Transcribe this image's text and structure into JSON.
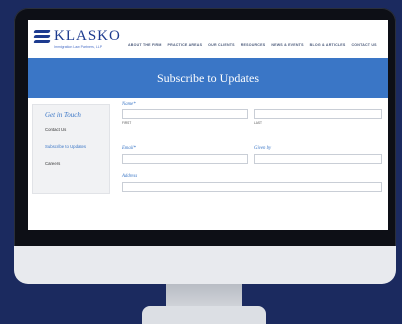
{
  "brand": {
    "name": "KLASKO",
    "tagline": "Immigration Law Partners, LLP"
  },
  "nav": [
    "ABOUT THE FIRM",
    "PRACTICE AREAS",
    "OUR CLIENTS",
    "RESOURCES",
    "NEWS & EVENTS",
    "BLOG & ARTICLES",
    "CONTACT US"
  ],
  "banner": {
    "title": "Subscribe to Updates"
  },
  "sidebar": {
    "title": "Get in Touch",
    "items": [
      "Contact Us",
      "Subscribe to Updates",
      "Careers"
    ]
  },
  "form": {
    "name_label": "Name*",
    "first_sub": "FIRST",
    "last_sub": "LAST",
    "email_label": "Email*",
    "given_by_label": "Given by",
    "address_label": "Address"
  },
  "colors": {
    "accent": "#3a76c6",
    "brand": "#1d3b8f",
    "background": "#1b2a5f"
  }
}
